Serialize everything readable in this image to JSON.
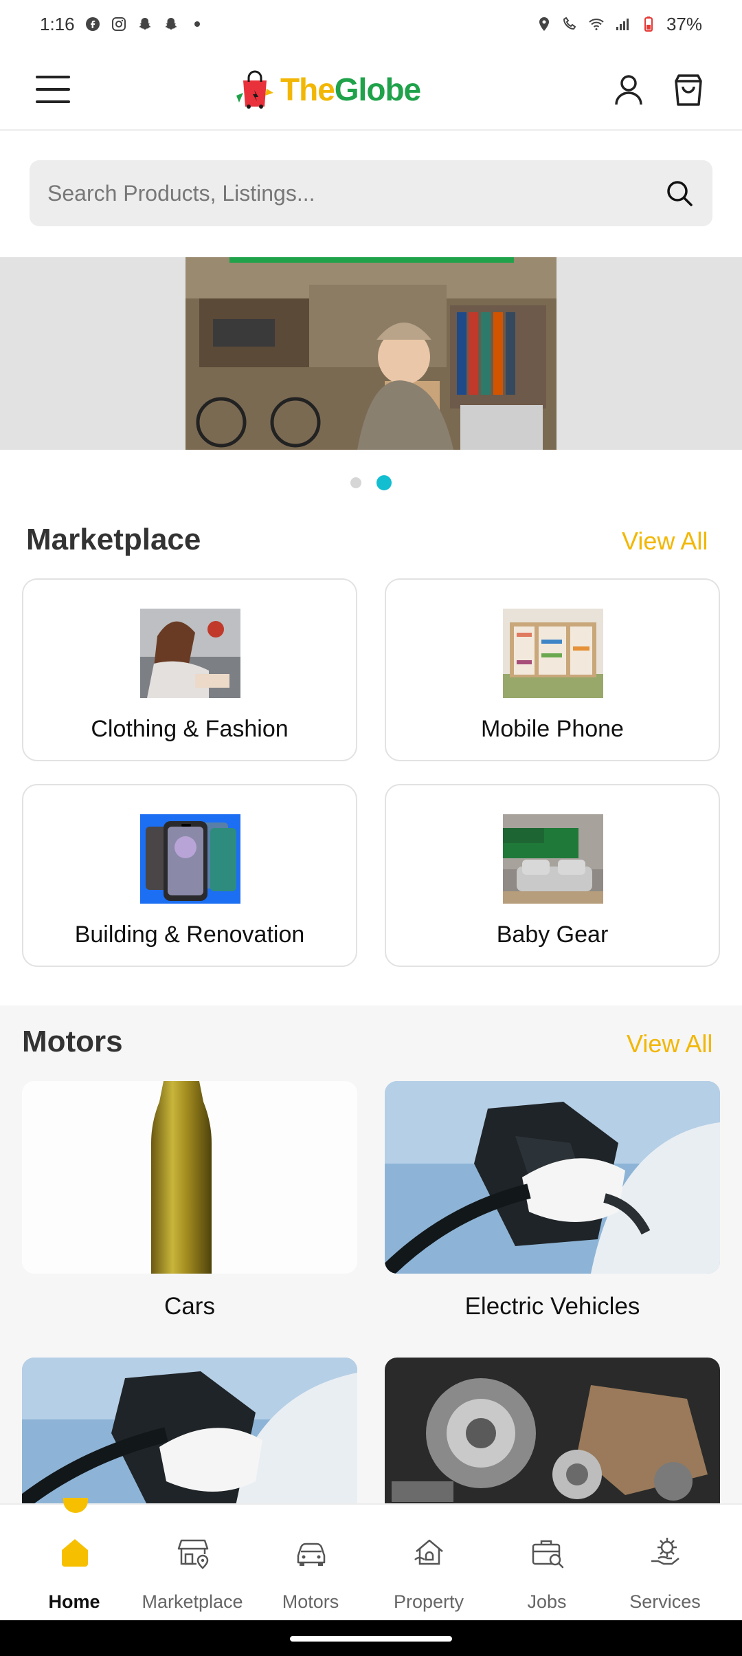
{
  "status_bar": {
    "time": "1:16",
    "notification_icons": [
      "facebook-icon",
      "instagram-icon",
      "snapchat-icon",
      "snapchat-icon",
      "dot-icon"
    ],
    "right_icons": [
      "location-icon",
      "wifi-call-icon",
      "wifi-icon",
      "signal-icon",
      "battery-icon"
    ],
    "battery": "37%"
  },
  "header": {
    "logo_part1": "The",
    "logo_part2": "Globe",
    "colors": {
      "logo_yellow": "#f2b705",
      "logo_green": "#1fa24a"
    }
  },
  "search": {
    "placeholder": "Search Products, Listings..."
  },
  "banner": {
    "image_desc": "person-with-boxes",
    "dots": 2,
    "active_dot": 2,
    "colors": {
      "active_dot": "#12bed0"
    }
  },
  "marketplace": {
    "title": "Marketplace",
    "view_all": "View All",
    "categories": [
      {
        "label": "Clothing & Fashion"
      },
      {
        "label": "Mobile Phone"
      },
      {
        "label": "Building & Renovation"
      },
      {
        "label": "Baby Gear"
      }
    ]
  },
  "motors": {
    "title": "Motors",
    "view_all": "View All",
    "categories": [
      {
        "label": "Cars"
      },
      {
        "label": "Electric Vehicles"
      },
      {
        "label": ""
      },
      {
        "label": ""
      }
    ]
  },
  "bottom_nav": {
    "items": [
      {
        "label": "Home",
        "icon": "home-icon",
        "active": true
      },
      {
        "label": "Marketplace",
        "icon": "store-icon",
        "active": false
      },
      {
        "label": "Motors",
        "icon": "car-icon",
        "active": false
      },
      {
        "label": "Property",
        "icon": "house-icon",
        "active": false
      },
      {
        "label": "Jobs",
        "icon": "briefcase-search-icon",
        "active": false
      },
      {
        "label": "Services",
        "icon": "gear-hand-icon",
        "active": false
      }
    ],
    "colors": {
      "accent": "#f6c000"
    }
  }
}
